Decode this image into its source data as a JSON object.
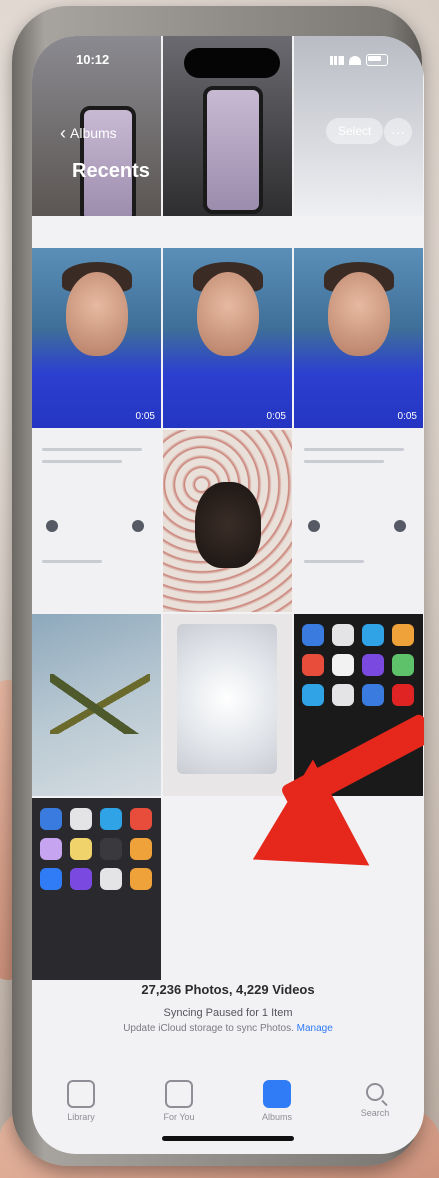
{
  "status_bar": {
    "time": "10:12"
  },
  "header": {
    "back_label": "Albums",
    "title": "Recents",
    "select_label": "Select",
    "more_label": "···"
  },
  "grid": {
    "durations": [
      "0:05",
      "0:05",
      "0:05"
    ]
  },
  "summary": {
    "count_text": "27,236 Photos, 4,229 Videos",
    "sync_text": "Syncing Paused for 1 Item",
    "sub_text": "Update iCloud storage to sync Photos.",
    "sub_link": "Manage"
  },
  "tabbar": {
    "items": [
      {
        "label": "Library"
      },
      {
        "label": "For You"
      },
      {
        "label": "Albums"
      },
      {
        "label": "Search"
      }
    ]
  },
  "colors": {
    "accent": "#2f7cf6",
    "arrow": "#e5271c"
  }
}
